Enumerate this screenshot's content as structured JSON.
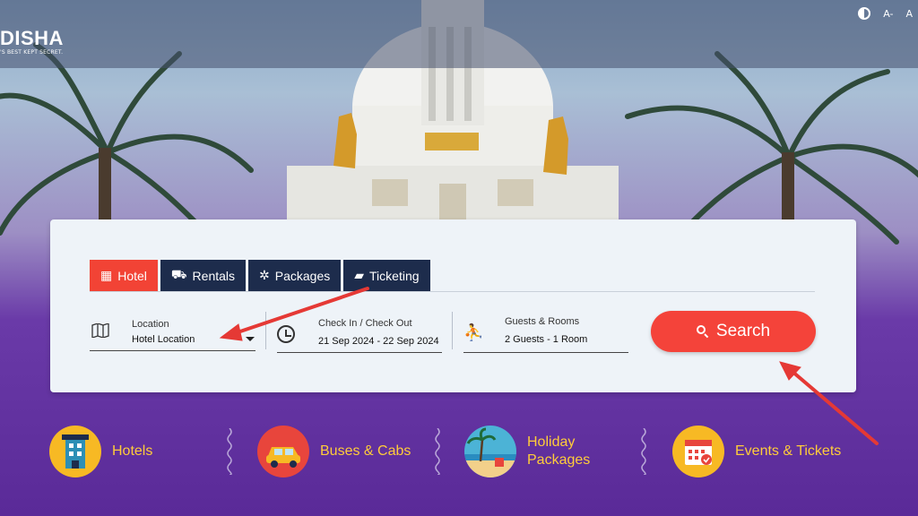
{
  "brand": {
    "name": "DISHA",
    "tagline": "'S BEST KEPT SECRET."
  },
  "top_controls": {
    "contrast_icon": "contrast-icon",
    "font_decrease": "A-",
    "font_normal": "A"
  },
  "tabs": [
    {
      "label": "Hotel",
      "icon": "hotel-icon",
      "active": true
    },
    {
      "label": "Rentals",
      "icon": "car-icon",
      "active": false
    },
    {
      "label": "Packages",
      "icon": "palm-tree-icon",
      "active": false
    },
    {
      "label": "Ticketing",
      "icon": "ticket-icon",
      "active": false
    }
  ],
  "fields": {
    "location": {
      "label": "Location",
      "value": "Hotel Location",
      "icon": "map-icon"
    },
    "dates": {
      "label": "Check In / Check Out",
      "value": "21 Sep 2024 - 22 Sep 2024",
      "icon": "clock-icon"
    },
    "guests": {
      "label": "Guests & Rooms",
      "value": "2 Guests - 1 Room",
      "icon": "traveler-icon"
    }
  },
  "search_button": {
    "label": "Search",
    "color": "#f4433a"
  },
  "quick_links": [
    {
      "label": "Hotels",
      "icon": "hotel-building-icon"
    },
    {
      "label": "Buses & Cabs",
      "icon": "car-icon"
    },
    {
      "label_line1": "Holiday",
      "label_line2": "Packages",
      "icon": "beach-icon"
    },
    {
      "label": "Events & Tickets",
      "icon": "calendar-icon"
    }
  ],
  "colors": {
    "accent": "#f24335",
    "tab_dark": "#1d2c4c",
    "quick_text": "#ffcc3a",
    "annotation": "#e53935"
  }
}
